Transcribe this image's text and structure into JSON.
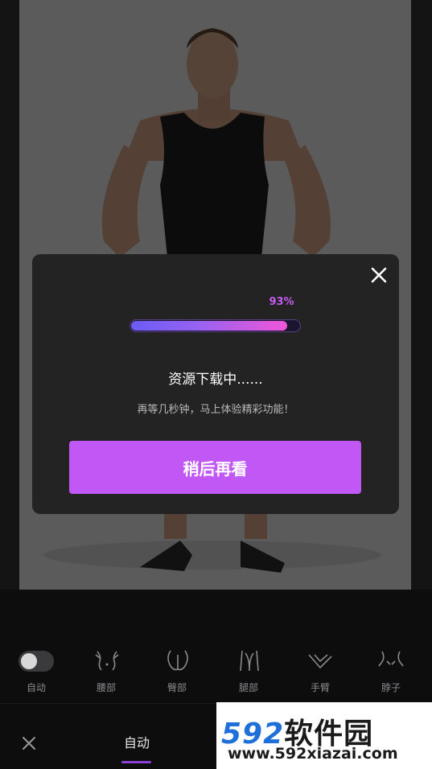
{
  "dialog": {
    "progress_percent": 93,
    "progress_label": "93%",
    "title": "资源下载中......",
    "subtitle": "再等几秒钟，马上体验精彩功能！",
    "later_button": "稍后再看"
  },
  "tools": [
    {
      "label": "自动",
      "icon": "toggle-switch"
    },
    {
      "label": "腰部",
      "icon": "waist-icon"
    },
    {
      "label": "臀部",
      "icon": "hip-icon"
    },
    {
      "label": "腿部",
      "icon": "leg-icon"
    },
    {
      "label": "手臂",
      "icon": "arm-icon"
    },
    {
      "label": "脖子",
      "icon": "neck-icon"
    }
  ],
  "bottom_bar": {
    "active_tab": "自动"
  },
  "watermark": {
    "logo_num": "592",
    "logo_cn": "软件园",
    "url": "www.592xiazai.com"
  },
  "colors": {
    "accent": "#c157f5",
    "progress_start": "#6b5cf5",
    "progress_end": "#f056d8"
  }
}
